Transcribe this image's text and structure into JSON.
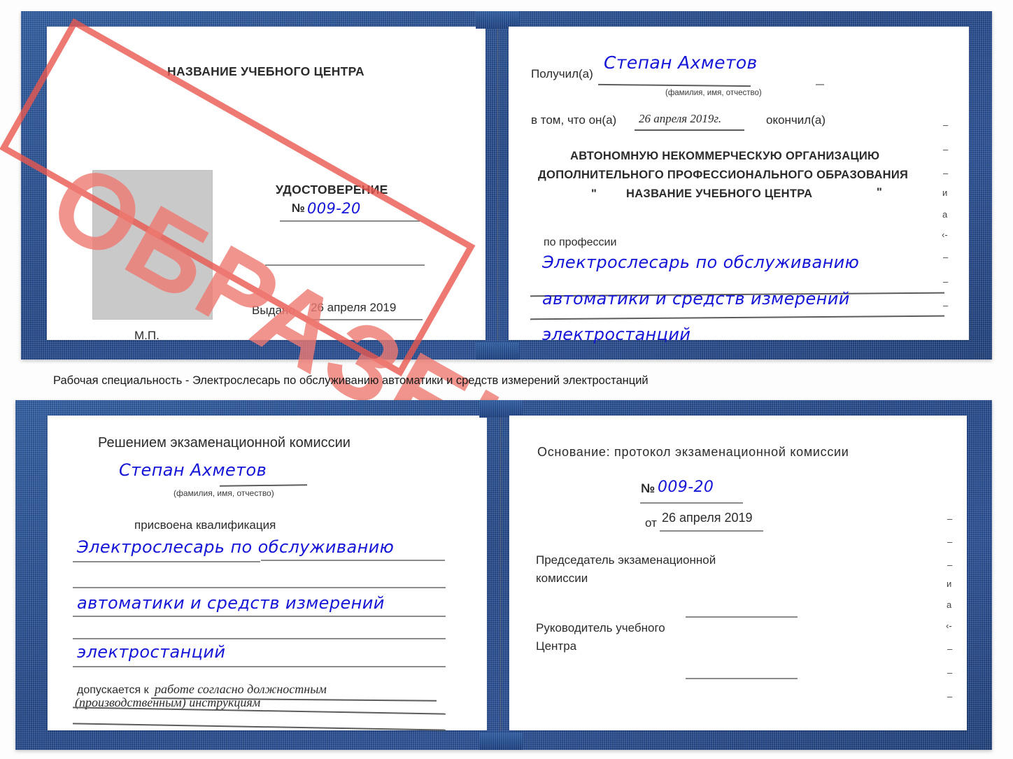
{
  "document": {
    "kind": "certificate-scan",
    "colors": {
      "cover_blue": "#1f4280",
      "handwriting_blue": "#1515d8",
      "stamp_red": "#e8584f",
      "rule_gray": "#8c8c8c",
      "photo_placeholder_gray": "#c9c9c9"
    }
  },
  "watermark": {
    "stamp_label": "ОБРАЗЕЦ"
  },
  "caption": {
    "text": "Рабочая специальность - Электрослесарь по обслуживанию автоматики и средств измерений электростанций"
  },
  "certificate_top": {
    "left_page": {
      "center_name": "НАЗВАНИЕ УЧЕБНОГО ЦЕНТРА",
      "title": "УДОСТОВЕРЕНИЕ",
      "number_label": "№",
      "number_value": "009-20",
      "issued_label": "Выдано",
      "issued_value": "26 апреля 2019",
      "seal_label": "М.П."
    },
    "right_page": {
      "received_label": "Получил(а)",
      "received_value": "Степан Ахметов",
      "fio_hint": "(фамилия, имя, отчество)",
      "in_that_label": "в том, что он(а)",
      "completion_date": "26 апреля 2019г.",
      "finished_label": "окончил(а)",
      "org_line1": "АВТОНОМНУЮ НЕКОММЕРЧЕСКУЮ ОРГАНИЗАЦИЮ",
      "org_line2": "ДОПОЛНИТЕЛЬНОГО ПРОФЕССИОНАЛЬНОГО ОБРАЗОВАНИЯ",
      "org_quote_open": "\"",
      "org_name": "НАЗВАНИЕ УЧЕБНОГО ЦЕНТРА",
      "org_quote_close": "\"",
      "profession_label": "по профессии",
      "profession_line1": "Электрослесарь по обслуживанию",
      "profession_line2": "автоматики и средств измерений",
      "profession_line3": "электростанций",
      "edge_fragments": [
        "–",
        "–",
        "–",
        "и",
        "а",
        "‹-",
        "–",
        "–",
        "–"
      ]
    }
  },
  "certificate_bottom": {
    "left_page": {
      "heading": "Решением экзаменационной комиссии",
      "name_value": "Степан Ахметов",
      "fio_hint": "(фамилия, имя, отчество)",
      "qualification_label": "присвоена квалификация",
      "qualification_line1": "Электрослесарь по обслуживанию",
      "qualification_line2": "автоматики и средств измерений",
      "qualification_line3": "электростанций",
      "allowed_label": "допускается к",
      "allowed_value_line1": "работе согласно должностным",
      "allowed_value_line2": "(производственным) инструкциям"
    },
    "right_page": {
      "basis_label": "Основание: протокол экзаменационной комиссии",
      "number_label": "№",
      "number_value": "009-20",
      "date_label": "от",
      "date_value": "26 апреля 2019",
      "chairman_line1": "Председатель экзаменационной",
      "chairman_line2": "комиссии",
      "head_line1": "Руководитель учебного",
      "head_line2": "Центра",
      "edge_fragments": [
        "–",
        "–",
        "–",
        "и",
        "а",
        "‹-",
        "–",
        "–",
        "–"
      ]
    }
  }
}
